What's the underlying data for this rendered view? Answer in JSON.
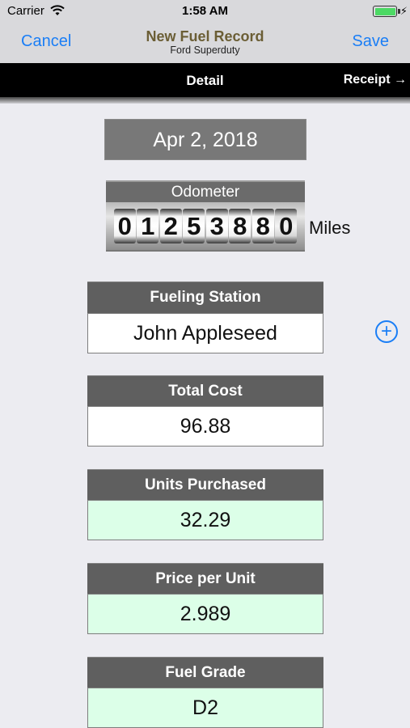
{
  "status_bar": {
    "carrier": "Carrier",
    "time": "1:58 AM",
    "battery_level": 1.0
  },
  "nav": {
    "cancel_label": "Cancel",
    "title": "New Fuel Record",
    "subtitle": "Ford Superduty",
    "save_label": "Save"
  },
  "tabs": {
    "detail_label": "Detail",
    "receipt_label": "Receipt →"
  },
  "record": {
    "date": "Apr 2, 2018",
    "odometer": {
      "label": "Odometer",
      "digits": [
        "0",
        "1",
        "2",
        "5",
        "3",
        "8",
        "8",
        "0"
      ],
      "units": "Miles"
    },
    "fueling_station": {
      "label": "Fueling Station",
      "value": "John Appleseed"
    },
    "total_cost": {
      "label": "Total Cost",
      "value": "96.88"
    },
    "units_purchased": {
      "label": "Units Purchased",
      "value": "32.29"
    },
    "price_per_unit": {
      "label": "Price per Unit",
      "value": "2.989"
    },
    "fuel_grade": {
      "label": "Fuel Grade",
      "value": "D2"
    }
  },
  "icons": {
    "add_station": "plus-circle-icon",
    "wifi": "wifi-icon",
    "battery": "battery-icon",
    "charging": "bolt-icon"
  },
  "colors": {
    "accent": "#1a7ef6",
    "nav_title": "#6b5e35",
    "label_bg": "#5f5f5f",
    "computed_field_bg": "#dcffe8"
  }
}
